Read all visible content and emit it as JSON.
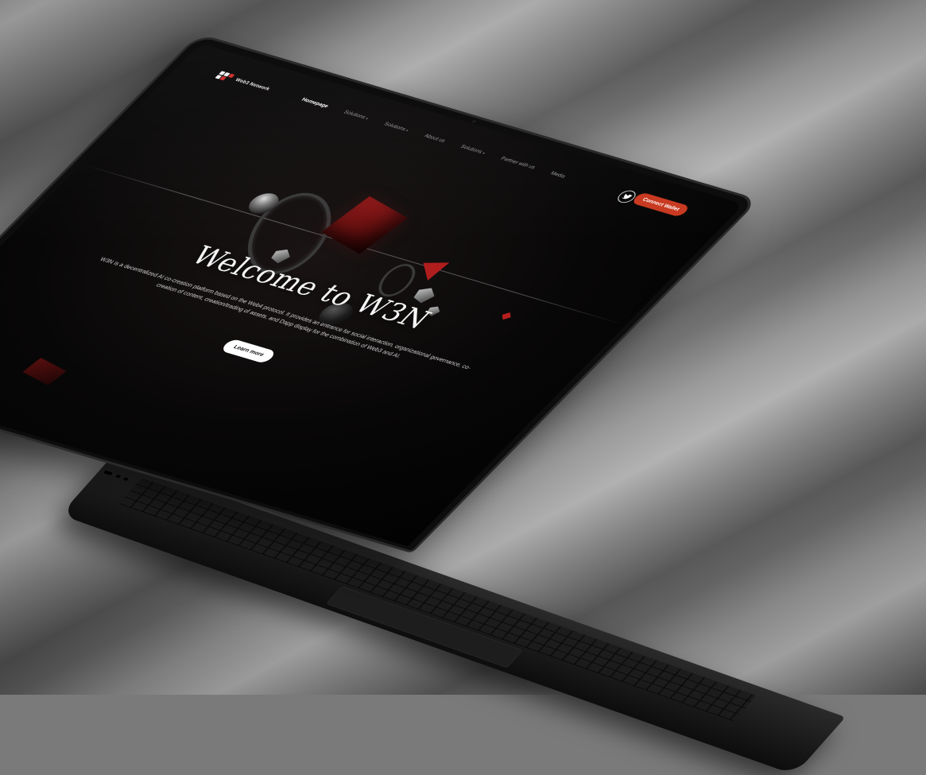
{
  "brand": {
    "name": "Web3 Network",
    "logo_icon": "w3n-logo-icon",
    "accent_color": "#c8381f"
  },
  "nav": {
    "items": [
      {
        "label": "Homepage",
        "active": true,
        "dropdown": false
      },
      {
        "label": "Solutions",
        "active": false,
        "dropdown": true
      },
      {
        "label": "Solutions",
        "active": false,
        "dropdown": true
      },
      {
        "label": "About us",
        "active": false,
        "dropdown": false
      },
      {
        "label": "Solutions",
        "active": false,
        "dropdown": true
      },
      {
        "label": "Partner with us",
        "active": false,
        "dropdown": false
      },
      {
        "label": "Media",
        "active": false,
        "dropdown": false
      }
    ],
    "dropdown_glyph": "▾",
    "twitter_icon": "twitter-icon",
    "connect_wallet_label": "Connect Wallet"
  },
  "hero": {
    "title": "Welcome to W3N",
    "description": "W3N is a decentralized AI co-creation platform based on the Web4 protocol. It provides an entrance for social interaction, organizational governance, co-creation of content, creation/trading of assets, and Dapp display for the combination of Web3 and AI.",
    "cta_label": "Learn more"
  }
}
